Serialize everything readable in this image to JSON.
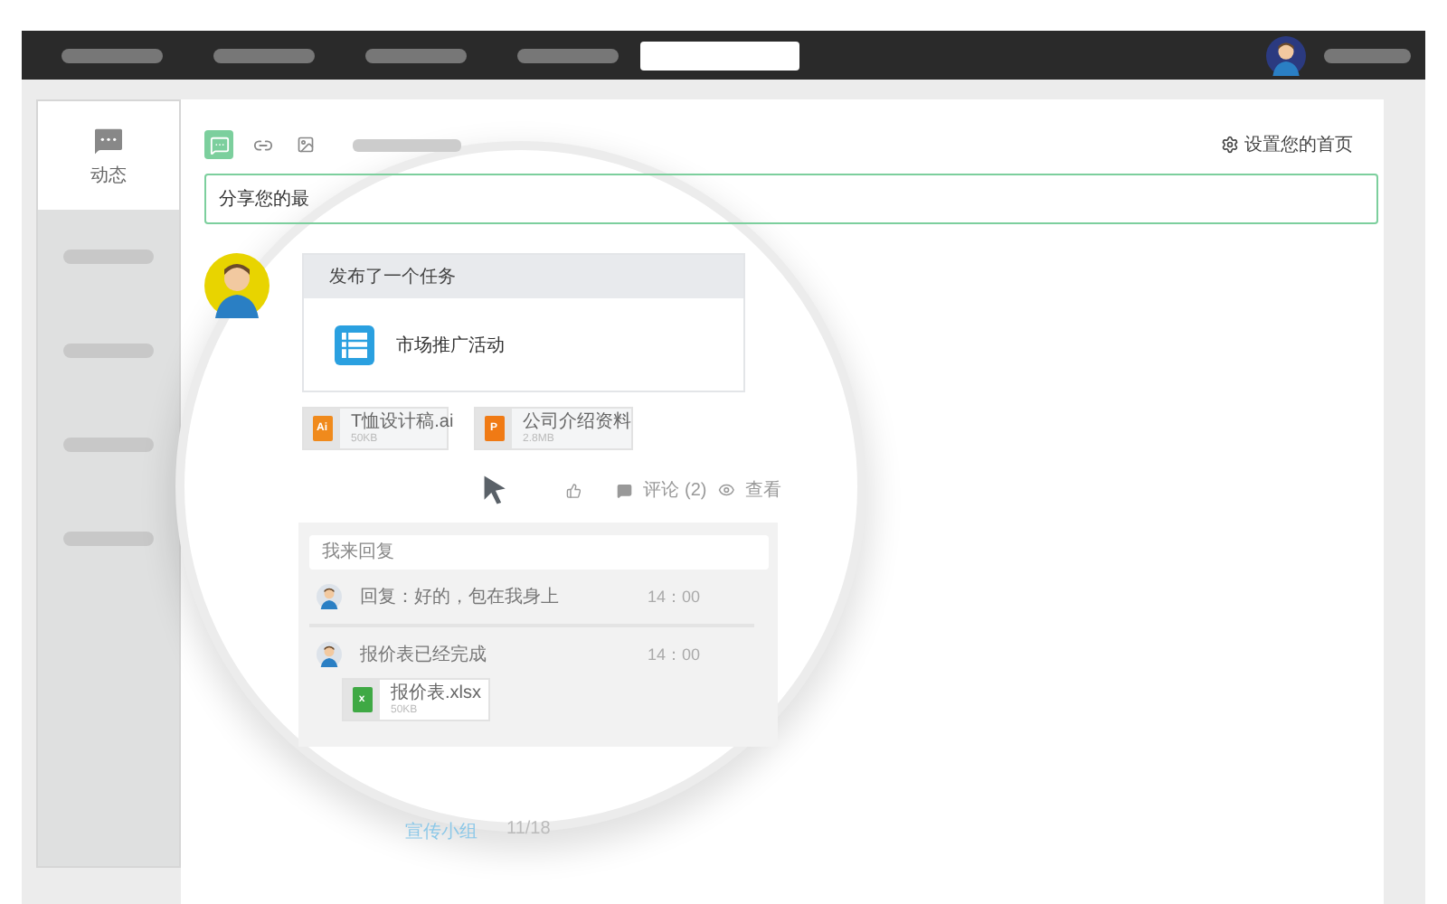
{
  "nav": {
    "items": [
      {
        "selected": false
      },
      {
        "selected": false
      },
      {
        "selected": false
      },
      {
        "selected": false
      },
      {
        "selected": true
      }
    ]
  },
  "sidebar": {
    "items": [
      {
        "label": "动态",
        "selected": true
      },
      {
        "selected": false
      },
      {
        "selected": false
      },
      {
        "selected": false
      },
      {
        "selected": false
      }
    ]
  },
  "composer": {
    "tools": [
      {
        "kind": "comment",
        "selected": true
      },
      {
        "kind": "link",
        "selected": false
      },
      {
        "kind": "image",
        "selected": false
      }
    ],
    "settings_link": "设置您的首页",
    "placeholder": "分享您的最"
  },
  "post": {
    "action": "发布了一个任务",
    "task": "市场推广活动",
    "attachments": [
      {
        "kind": "ai",
        "icon_label": "Ai",
        "name": "T恤设计稿.ai",
        "size": "50KB"
      },
      {
        "kind": "ppt",
        "icon_label": "P",
        "name": "公司介绍资料",
        "size": "2.8MB"
      }
    ],
    "comment_label": "评论",
    "comment_count": "(2)",
    "view_label": "查看"
  },
  "replies": {
    "placeholder": "我来回复",
    "items": [
      {
        "text": "回复：好的，包在我身上",
        "time": "14：00"
      },
      {
        "text": "报价表已经完成",
        "time": "14：00",
        "attachment": {
          "kind": "xls",
          "icon_label": "x",
          "name": "报价表.xlsx",
          "size": "50KB"
        }
      }
    ]
  },
  "footer": {
    "group": "宣传小组",
    "date": "11/18"
  }
}
